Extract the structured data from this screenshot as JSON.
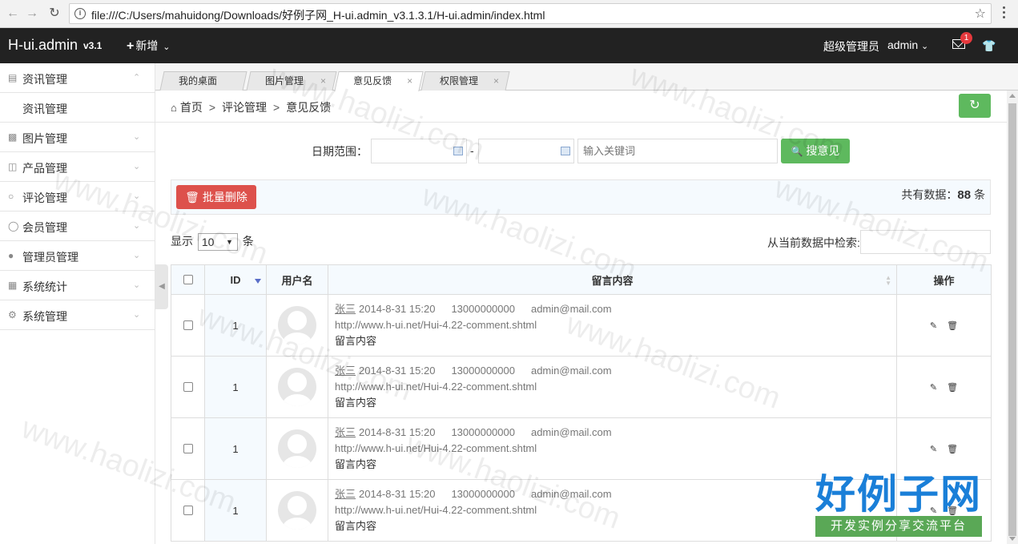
{
  "browser": {
    "url": "file:///C:/Users/mahuidong/Downloads/好例子网_H-ui.admin_v3.1.3.1/H-ui.admin/index.html"
  },
  "header": {
    "logo": "H-ui.admin",
    "version": "v3.1",
    "add_label": "新增",
    "role": "超级管理员",
    "user": "admin",
    "msg_count": "1"
  },
  "sidebar": {
    "items": [
      {
        "label": "资讯管理",
        "icon": "news-icon"
      },
      {
        "label": "资讯管理"
      },
      {
        "label": "图片管理",
        "icon": "picture-icon"
      },
      {
        "label": "产品管理",
        "icon": "product-icon"
      },
      {
        "label": "评论管理",
        "icon": "comment-icon"
      },
      {
        "label": "会员管理",
        "icon": "member-icon"
      },
      {
        "label": "管理员管理",
        "icon": "admin-icon"
      },
      {
        "label": "系统统计",
        "icon": "stats-icon"
      },
      {
        "label": "系统管理",
        "icon": "gear-icon"
      }
    ]
  },
  "tabs": [
    {
      "label": "我的桌面"
    },
    {
      "label": "图片管理"
    },
    {
      "label": "意见反馈"
    },
    {
      "label": "权限管理"
    }
  ],
  "breadcrumb": {
    "home": "首页",
    "sep": ">",
    "level1": "评论管理",
    "level2": "意见反馈"
  },
  "search": {
    "date_label": "日期范围：",
    "dash": "-",
    "keyword_placeholder": "输入关键词",
    "button": "搜意见"
  },
  "toolbar": {
    "delete_label": "批量删除",
    "total_prefix": "共有数据：",
    "total_count": "88",
    "total_suffix": " 条"
  },
  "table_controls": {
    "show_label": "显示",
    "page_size": "10",
    "unit": "条",
    "filter_label": "从当前数据中检索:"
  },
  "table": {
    "headers": [
      "ID",
      "用户名",
      "留言内容",
      "操作"
    ],
    "rows": [
      {
        "id": "1",
        "name": "张三",
        "time": "2014-8-31 15:20",
        "phone": "13000000000",
        "email": "admin@mail.com",
        "url": "http://www.h-ui.net/Hui-4.22-comment.shtml",
        "content": "留言内容"
      },
      {
        "id": "1",
        "name": "张三",
        "time": "2014-8-31 15:20",
        "phone": "13000000000",
        "email": "admin@mail.com",
        "url": "http://www.h-ui.net/Hui-4.22-comment.shtml",
        "content": "留言内容"
      },
      {
        "id": "1",
        "name": "张三",
        "time": "2014-8-31 15:20",
        "phone": "13000000000",
        "email": "admin@mail.com",
        "url": "http://www.h-ui.net/Hui-4.22-comment.shtml",
        "content": "留言内容"
      },
      {
        "id": "1",
        "name": "张三",
        "time": "2014-8-31 15:20",
        "phone": "13000000000",
        "email": "admin@mail.com",
        "url": "http://www.h-ui.net/Hui-4.22-comment.shtml",
        "content": "留言内容"
      }
    ]
  },
  "watermark": {
    "text": "www.haolizi.com",
    "brand_big": "好例子网",
    "brand_small": "开发实例分享交流平台"
  },
  "colors": {
    "header_bg": "#222222",
    "green": "#5eb95e",
    "red": "#dd514c",
    "brand_blue": "#1a7fd8"
  }
}
